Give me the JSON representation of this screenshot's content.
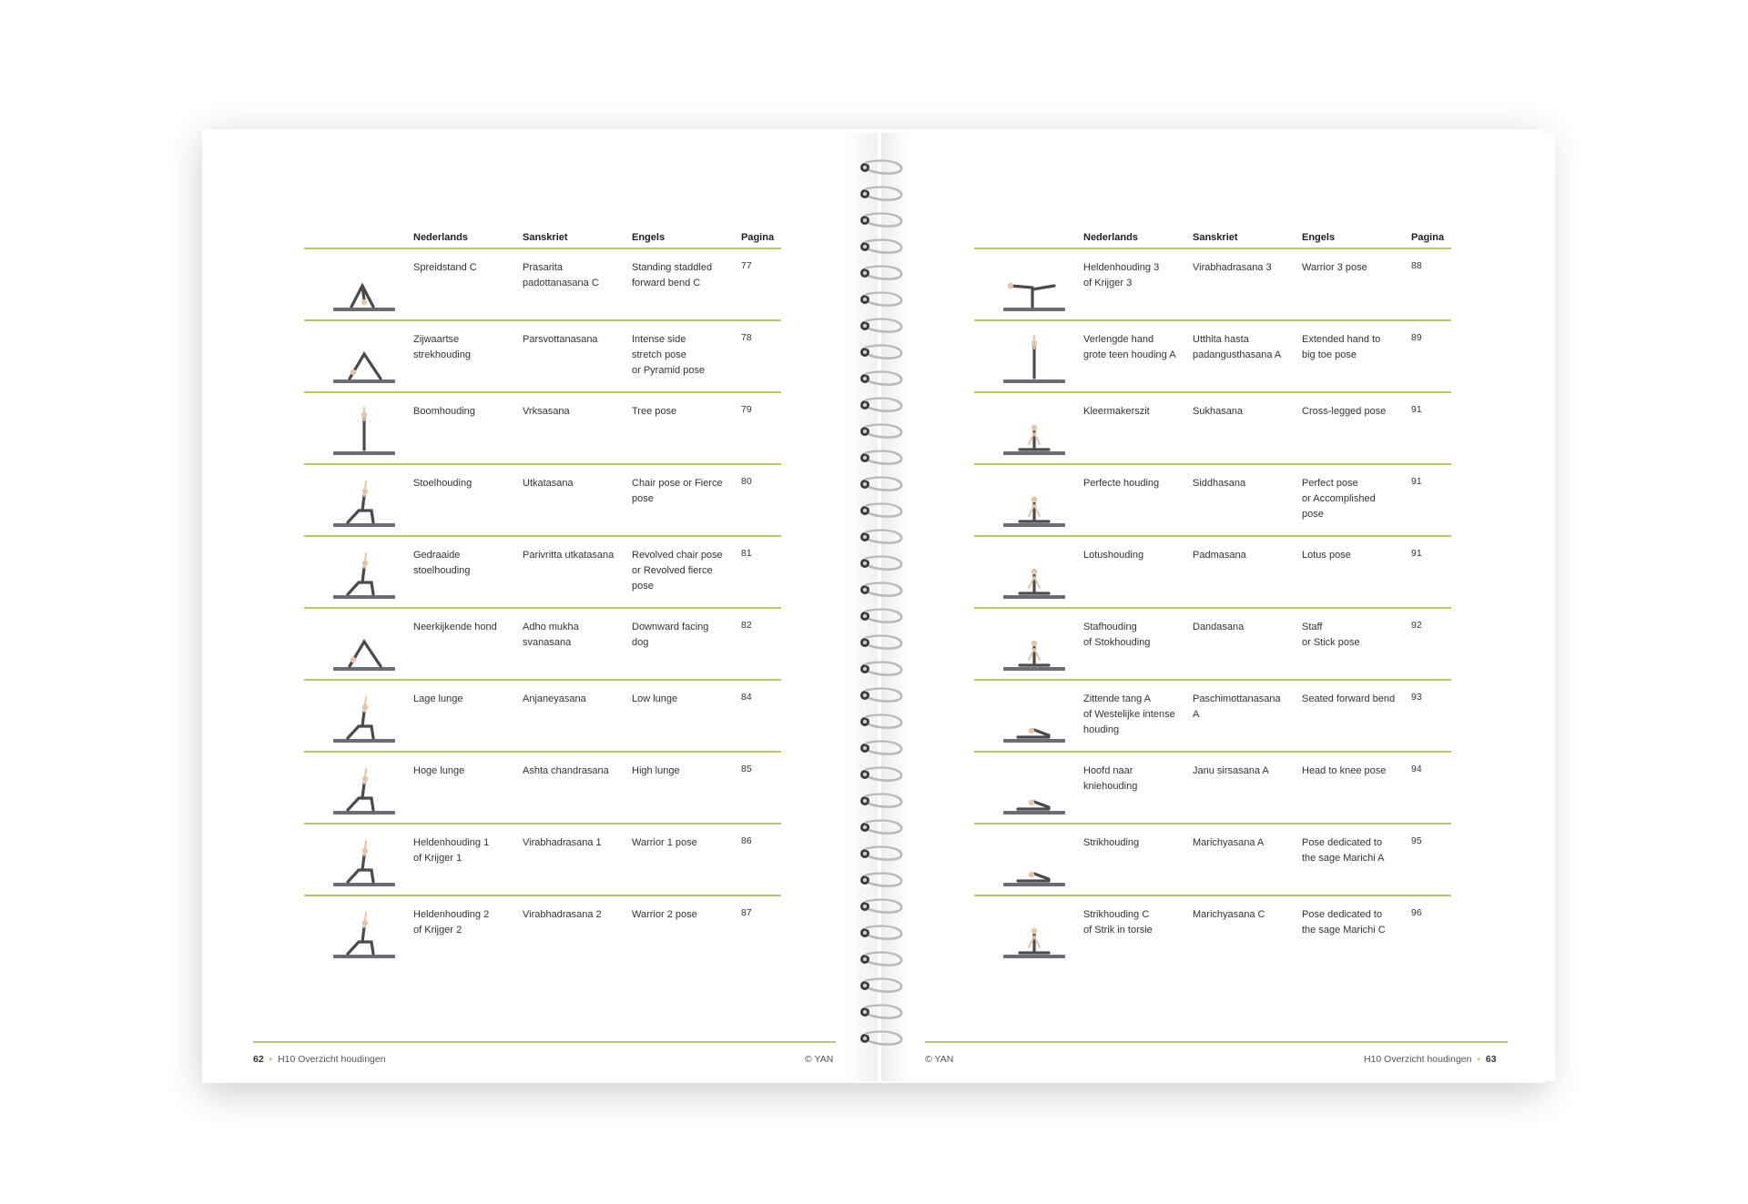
{
  "colors": {
    "accent": "#b5c86e",
    "text": "#333333",
    "mat": "#6f6b75",
    "figure": "#4a4a4f",
    "skin": "#e8c3a4"
  },
  "headers": {
    "dutch": "Nederlands",
    "sanskrit": "Sanskriet",
    "english": "Engels",
    "page": "Pagina"
  },
  "left_rows": [
    {
      "dutch": "Spreidstand C",
      "sanskrit": "Prasarita\npadottanasana C",
      "english": "Standing staddled\nforward bend C",
      "page": "77",
      "pose_icon": "wide-forward-bend-icon"
    },
    {
      "dutch": "Zijwaartse\nstrekhouding",
      "sanskrit": "Parsvottanasana",
      "english": "Intense side\nstretch pose\nor Pyramid pose",
      "page": "78",
      "pose_icon": "pyramid-pose-icon"
    },
    {
      "dutch": "Boomhouding",
      "sanskrit": "Vrksasana",
      "english": "Tree pose",
      "page": "79",
      "pose_icon": "tree-pose-icon"
    },
    {
      "dutch": "Stoelhouding",
      "sanskrit": "Utkatasana",
      "english": "Chair pose or Fierce\npose",
      "page": "80",
      "pose_icon": "chair-pose-icon"
    },
    {
      "dutch": "Gedraaide\nstoelhouding",
      "sanskrit": "Parivritta utkatasana",
      "english": "Revolved chair pose\nor Revolved fierce\npose",
      "page": "81",
      "pose_icon": "revolved-chair-pose-icon"
    },
    {
      "dutch": "Neerkijkende hond",
      "sanskrit": "Adho mukha\nsvanasana",
      "english": "Downward facing\ndog",
      "page": "82",
      "pose_icon": "downward-dog-icon"
    },
    {
      "dutch": "Lage lunge",
      "sanskrit": "Anjaneyasana",
      "english": "Low lunge",
      "page": "84",
      "pose_icon": "low-lunge-icon"
    },
    {
      "dutch": "Hoge lunge",
      "sanskrit": "Ashta chandrasana",
      "english": "High lunge",
      "page": "85",
      "pose_icon": "high-lunge-icon"
    },
    {
      "dutch": "Heldenhouding 1\nof Krijger 1",
      "sanskrit": "Virabhadrasana 1",
      "english": "Warrior 1 pose",
      "page": "86",
      "pose_icon": "warrior-1-icon"
    },
    {
      "dutch": "Heldenhouding 2\nof Krijger 2",
      "sanskrit": "Virabhadrasana 2",
      "english": "Warrior 2 pose",
      "page": "87",
      "pose_icon": "warrior-2-icon"
    }
  ],
  "right_rows": [
    {
      "dutch": "Heldenhouding 3\nof Krijger 3",
      "sanskrit": "Virabhadrasana 3",
      "english": "Warrior 3 pose",
      "page": "88",
      "pose_icon": "warrior-3-icon"
    },
    {
      "dutch": "Verlengde hand\ngrote teen houding A",
      "sanskrit": "Utthita hasta\npadangusthasana A",
      "english": "Extended hand to\nbig toe pose",
      "page": "89",
      "pose_icon": "extended-hand-to-toe-icon"
    },
    {
      "dutch": "Kleermakerszit",
      "sanskrit": "Sukhasana",
      "english": "Cross-legged pose",
      "page": "91",
      "pose_icon": "cross-legged-icon"
    },
    {
      "dutch": "Perfecte houding",
      "sanskrit": "Siddhasana",
      "english": "Perfect pose\nor Accomplished\npose",
      "page": "91",
      "pose_icon": "perfect-pose-icon"
    },
    {
      "dutch": "Lotushouding",
      "sanskrit": "Padmasana",
      "english": "Lotus pose",
      "page": "91",
      "pose_icon": "lotus-pose-icon"
    },
    {
      "dutch": "Stafhouding\nof Stokhouding",
      "sanskrit": "Dandasana",
      "english": "Staff\nor Stick pose",
      "page": "92",
      "pose_icon": "staff-pose-icon"
    },
    {
      "dutch": "Zittende tang A\nof Westelijke intense\nhouding",
      "sanskrit": "Paschimottanasana\nA",
      "english": "Seated forward bend",
      "page": "93",
      "pose_icon": "seated-forward-bend-icon"
    },
    {
      "dutch": "Hoofd naar\nkniehouding",
      "sanskrit": "Janu sirsasana A",
      "english": "Head to knee pose",
      "page": "94",
      "pose_icon": "head-to-knee-icon"
    },
    {
      "dutch": "Strikhouding",
      "sanskrit": "Marichyasana A",
      "english": "Pose dedicated to\nthe sage Marichi A",
      "page": "95",
      "pose_icon": "marichyasana-a-icon"
    },
    {
      "dutch": "Strikhouding C\nof Strik in torsie",
      "sanskrit": "Marichyasana C",
      "english": "Pose dedicated to\nthe sage Marichi C",
      "page": "96",
      "pose_icon": "marichyasana-c-icon"
    }
  ],
  "footer": {
    "left_page_number": "62",
    "bullet": "•",
    "chapter": "H10 Overzicht houdingen",
    "copyright": "© YAN",
    "right_page_number": "63"
  }
}
